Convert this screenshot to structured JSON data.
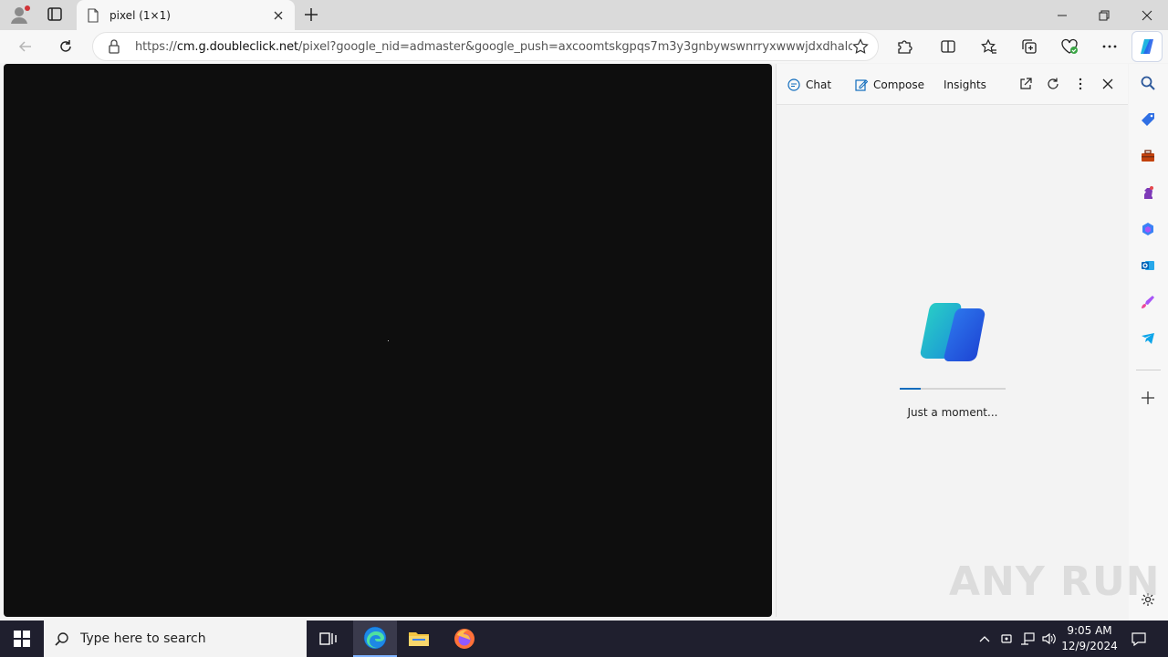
{
  "browser": {
    "tab_title": "pixel (1×1)",
    "url_prefix": "https://",
    "url_domain": "cm.g.doubleclick.net",
    "url_rest": "/pixel?google_nid=admaster&google_push=axcoomtskgpqs7m3y3gnbywswnrryxwwwjdxdhalc4t..."
  },
  "copilot": {
    "tabs": {
      "chat": "Chat",
      "compose": "Compose",
      "insights": "Insights"
    },
    "loading_text": "Just a moment...",
    "progress": 0.2,
    "accent": "#0f6cbd"
  },
  "watermark": "ANY RUN",
  "taskbar": {
    "search_placeholder": "Type here to search",
    "time": "9:05 AM",
    "date": "12/9/2024"
  },
  "icons": {
    "sidebar": [
      "search-icon",
      "shopping-tag-icon",
      "toolbox-icon",
      "chess-icon",
      "microsoft365-icon",
      "outlook-icon",
      "designer-icon",
      "telegram-icon",
      "add-icon",
      "settings-icon"
    ]
  }
}
